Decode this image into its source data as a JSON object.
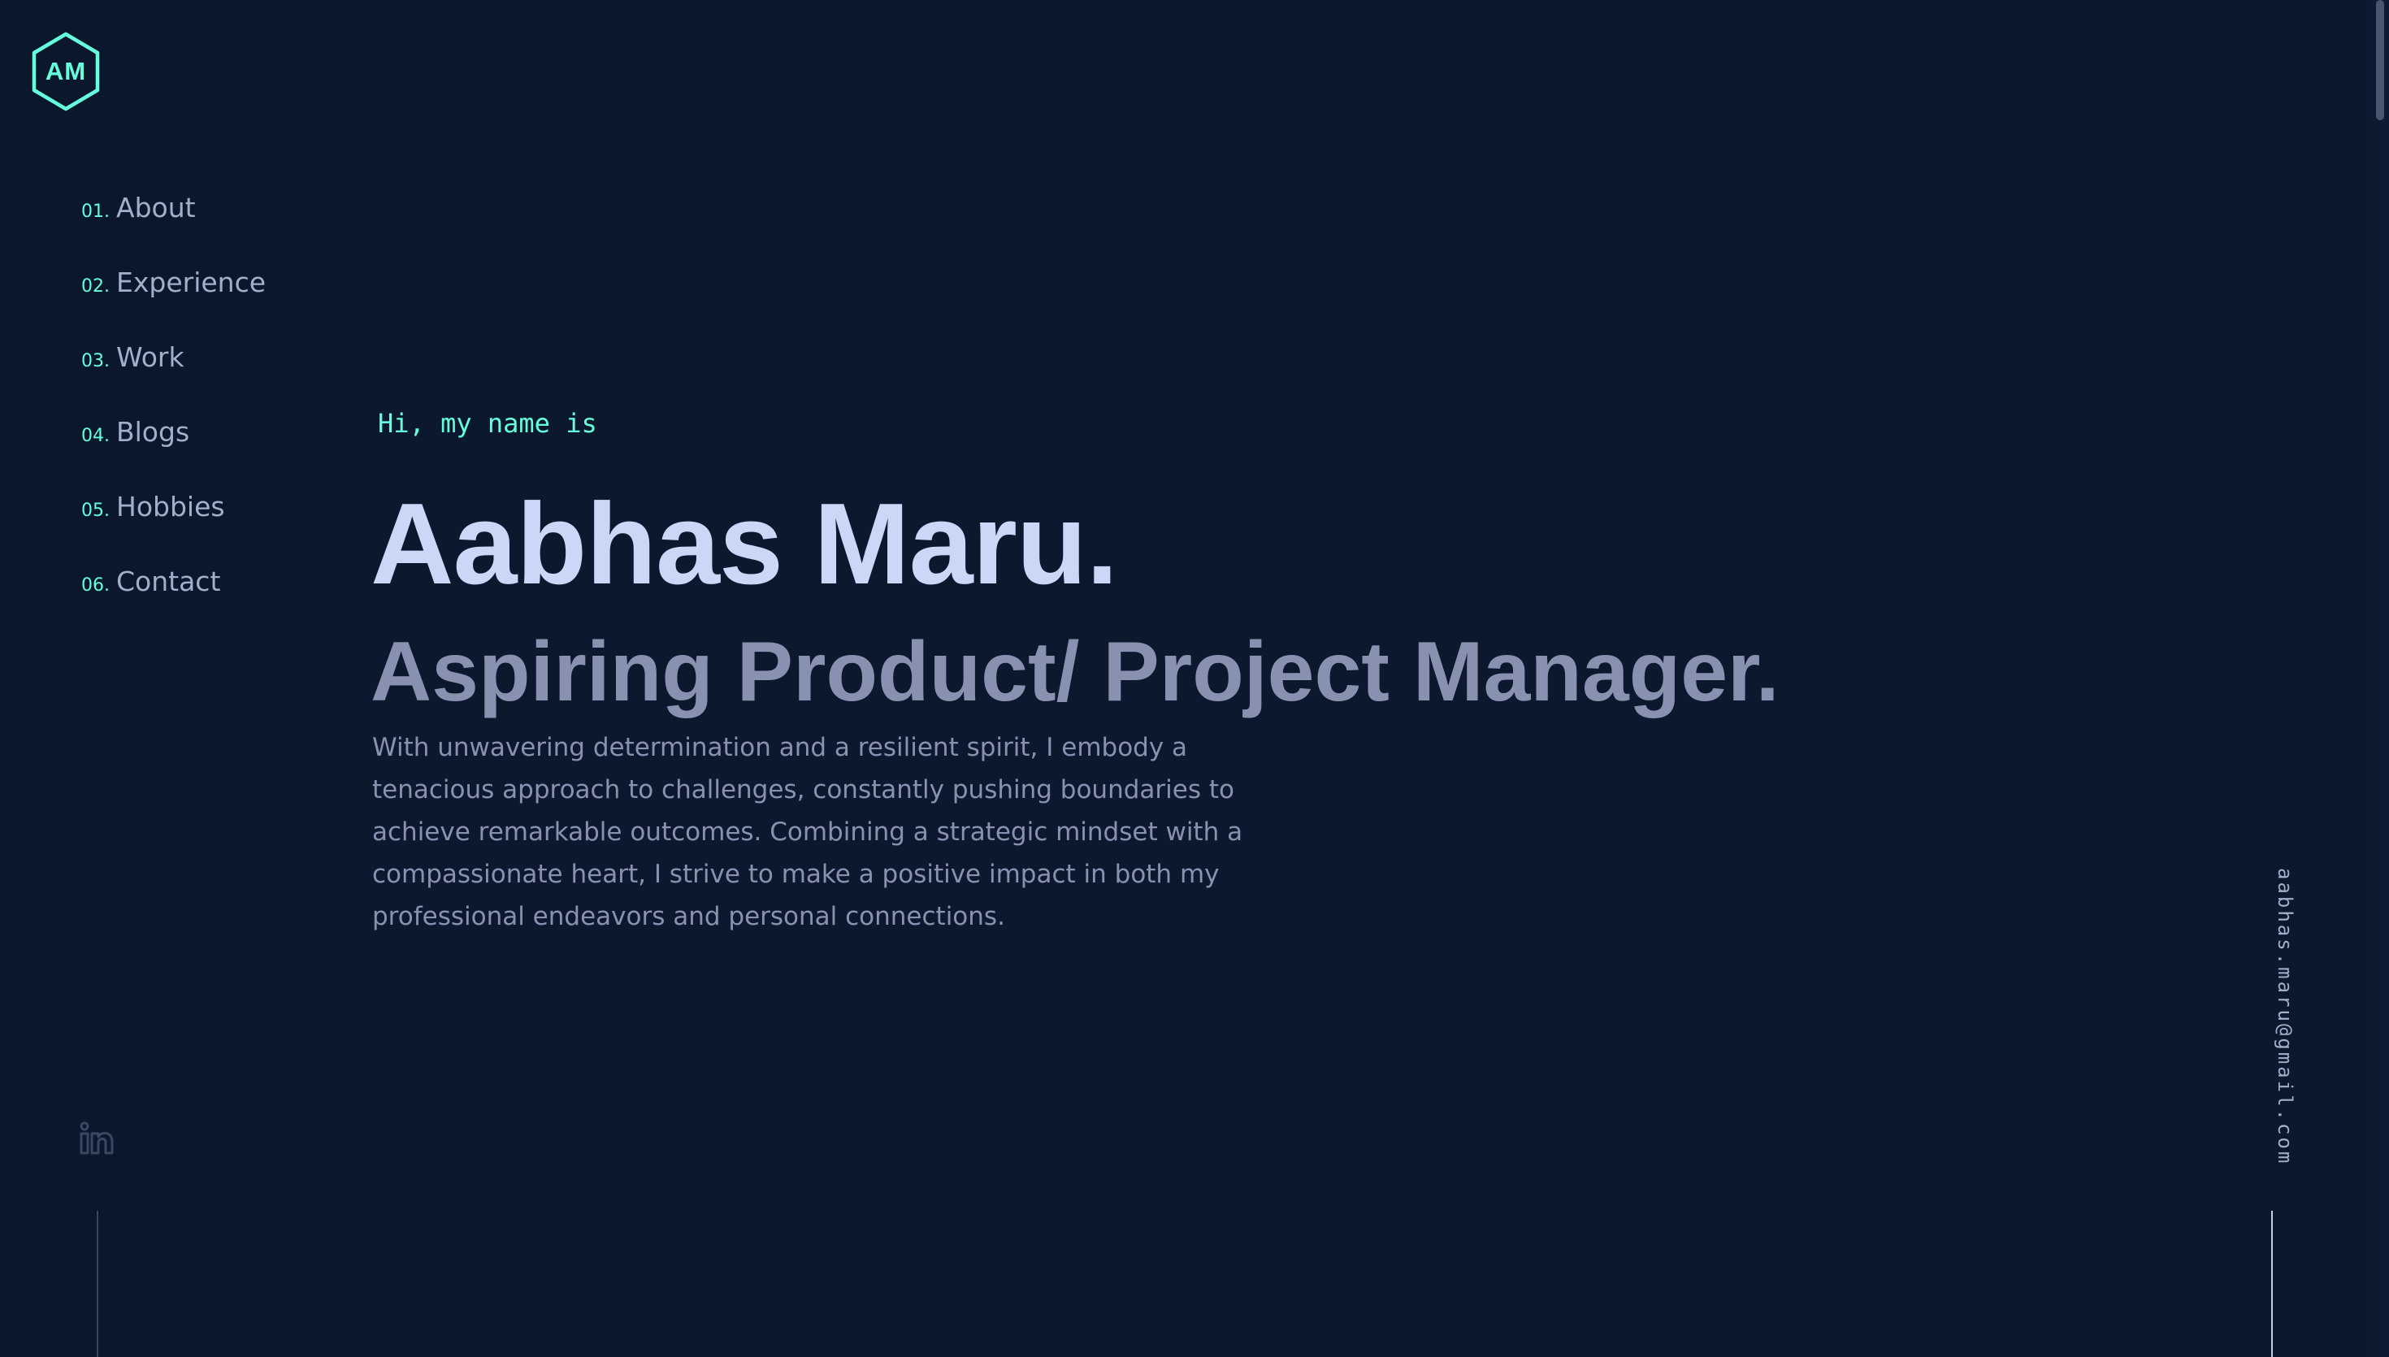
{
  "logo": {
    "initials": "AM",
    "icon": "hexagon-icon",
    "color": "#64ffda"
  },
  "nav": {
    "items": [
      {
        "num": "01.",
        "label": "About"
      },
      {
        "num": "02.",
        "label": "Experience"
      },
      {
        "num": "03.",
        "label": "Work"
      },
      {
        "num": "04.",
        "label": "Blogs"
      },
      {
        "num": "05.",
        "label": "Hobbies"
      },
      {
        "num": "06.",
        "label": "Contact"
      }
    ]
  },
  "social": {
    "linkedin_icon": "linkedin-icon"
  },
  "hero": {
    "greeting": "Hi, my name is",
    "name": "Aabhas Maru.",
    "tagline": "Aspiring Product/ Project Manager.",
    "bio": "With unwavering determination and a resilient spirit, I embody a tenacious approach to challenges, constantly pushing boundaries to achieve remarkable outcomes. Combining a strategic mindset with a compassionate heart, I strive to make a positive impact in both my professional endeavors and personal connections."
  },
  "contact": {
    "email": "aabhas.maru@gmail.com"
  },
  "colors": {
    "background": "#0c182e",
    "accent": "#64ffda",
    "heading": "#ccd6f6",
    "muted": "#8892b0"
  }
}
